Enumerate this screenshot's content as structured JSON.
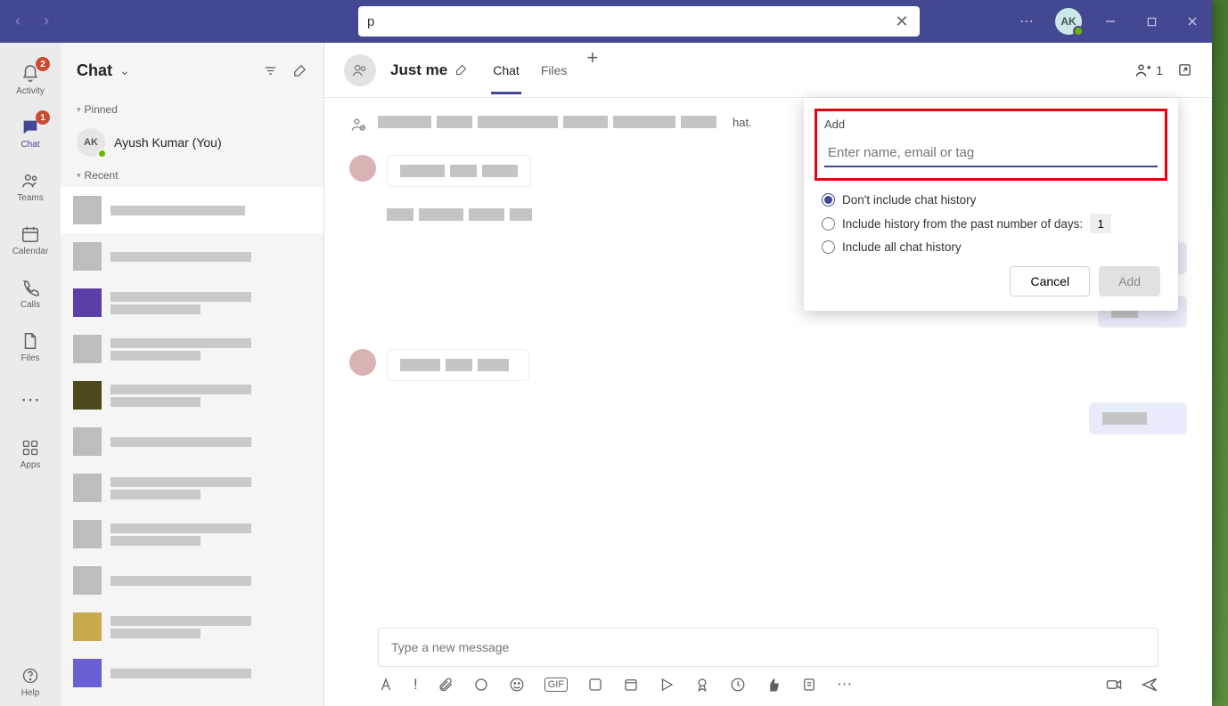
{
  "titlebar": {
    "search_value": "p"
  },
  "user": {
    "initials": "AK"
  },
  "rail": {
    "items": [
      {
        "id": "activity",
        "label": "Activity",
        "badge": "2"
      },
      {
        "id": "chat",
        "label": "Chat",
        "badge": "1"
      },
      {
        "id": "teams",
        "label": "Teams"
      },
      {
        "id": "calendar",
        "label": "Calendar"
      },
      {
        "id": "calls",
        "label": "Calls"
      },
      {
        "id": "files",
        "label": "Files"
      }
    ],
    "apps_label": "Apps",
    "help_label": "Help"
  },
  "chatlist": {
    "title": "Chat",
    "sections": {
      "pinned": "Pinned",
      "recent": "Recent"
    },
    "pinned_user": {
      "initials": "AK",
      "name": "Ayush Kumar (You)"
    }
  },
  "chatpane": {
    "title": "Just me",
    "tabs": {
      "chat": "Chat",
      "files": "Files"
    },
    "participants": "1",
    "compose_placeholder": "Type a new message",
    "status_text": "hat."
  },
  "popover": {
    "title": "Add",
    "input_placeholder": "Enter name, email or tag",
    "options": {
      "none": "Don't include chat history",
      "days_prefix": "Include history from the past number of days:",
      "days_value": "1",
      "all": "Include all chat history"
    },
    "buttons": {
      "cancel": "Cancel",
      "add": "Add"
    }
  }
}
